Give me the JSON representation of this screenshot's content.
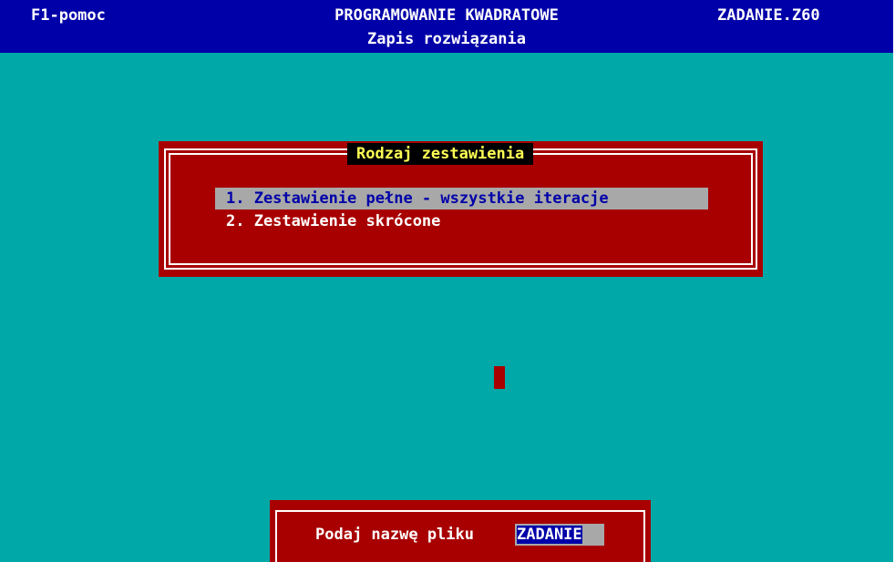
{
  "header": {
    "help": "F1-pomoc",
    "title": "PROGRAMOWANIE KWADRATOWE",
    "subtitle": "Zapis rozwiązania",
    "file": "ZADANIE.Z60"
  },
  "dialog": {
    "title": "Rodzaj zestawienia",
    "items": [
      {
        "label": "1. Zestawienie pełne - wszystkie iteracje",
        "selected": true
      },
      {
        "label": "2. Zestawienie skrócone",
        "selected": false
      }
    ]
  },
  "prompt": {
    "label": "Podaj nazwę pliku",
    "value": "ZADANIE"
  },
  "colors": {
    "background": "#00a8a8",
    "header": "#0000a8",
    "dialog": "#a80000",
    "highlight": "#a8a8a8",
    "title_text": "#ffff55"
  }
}
